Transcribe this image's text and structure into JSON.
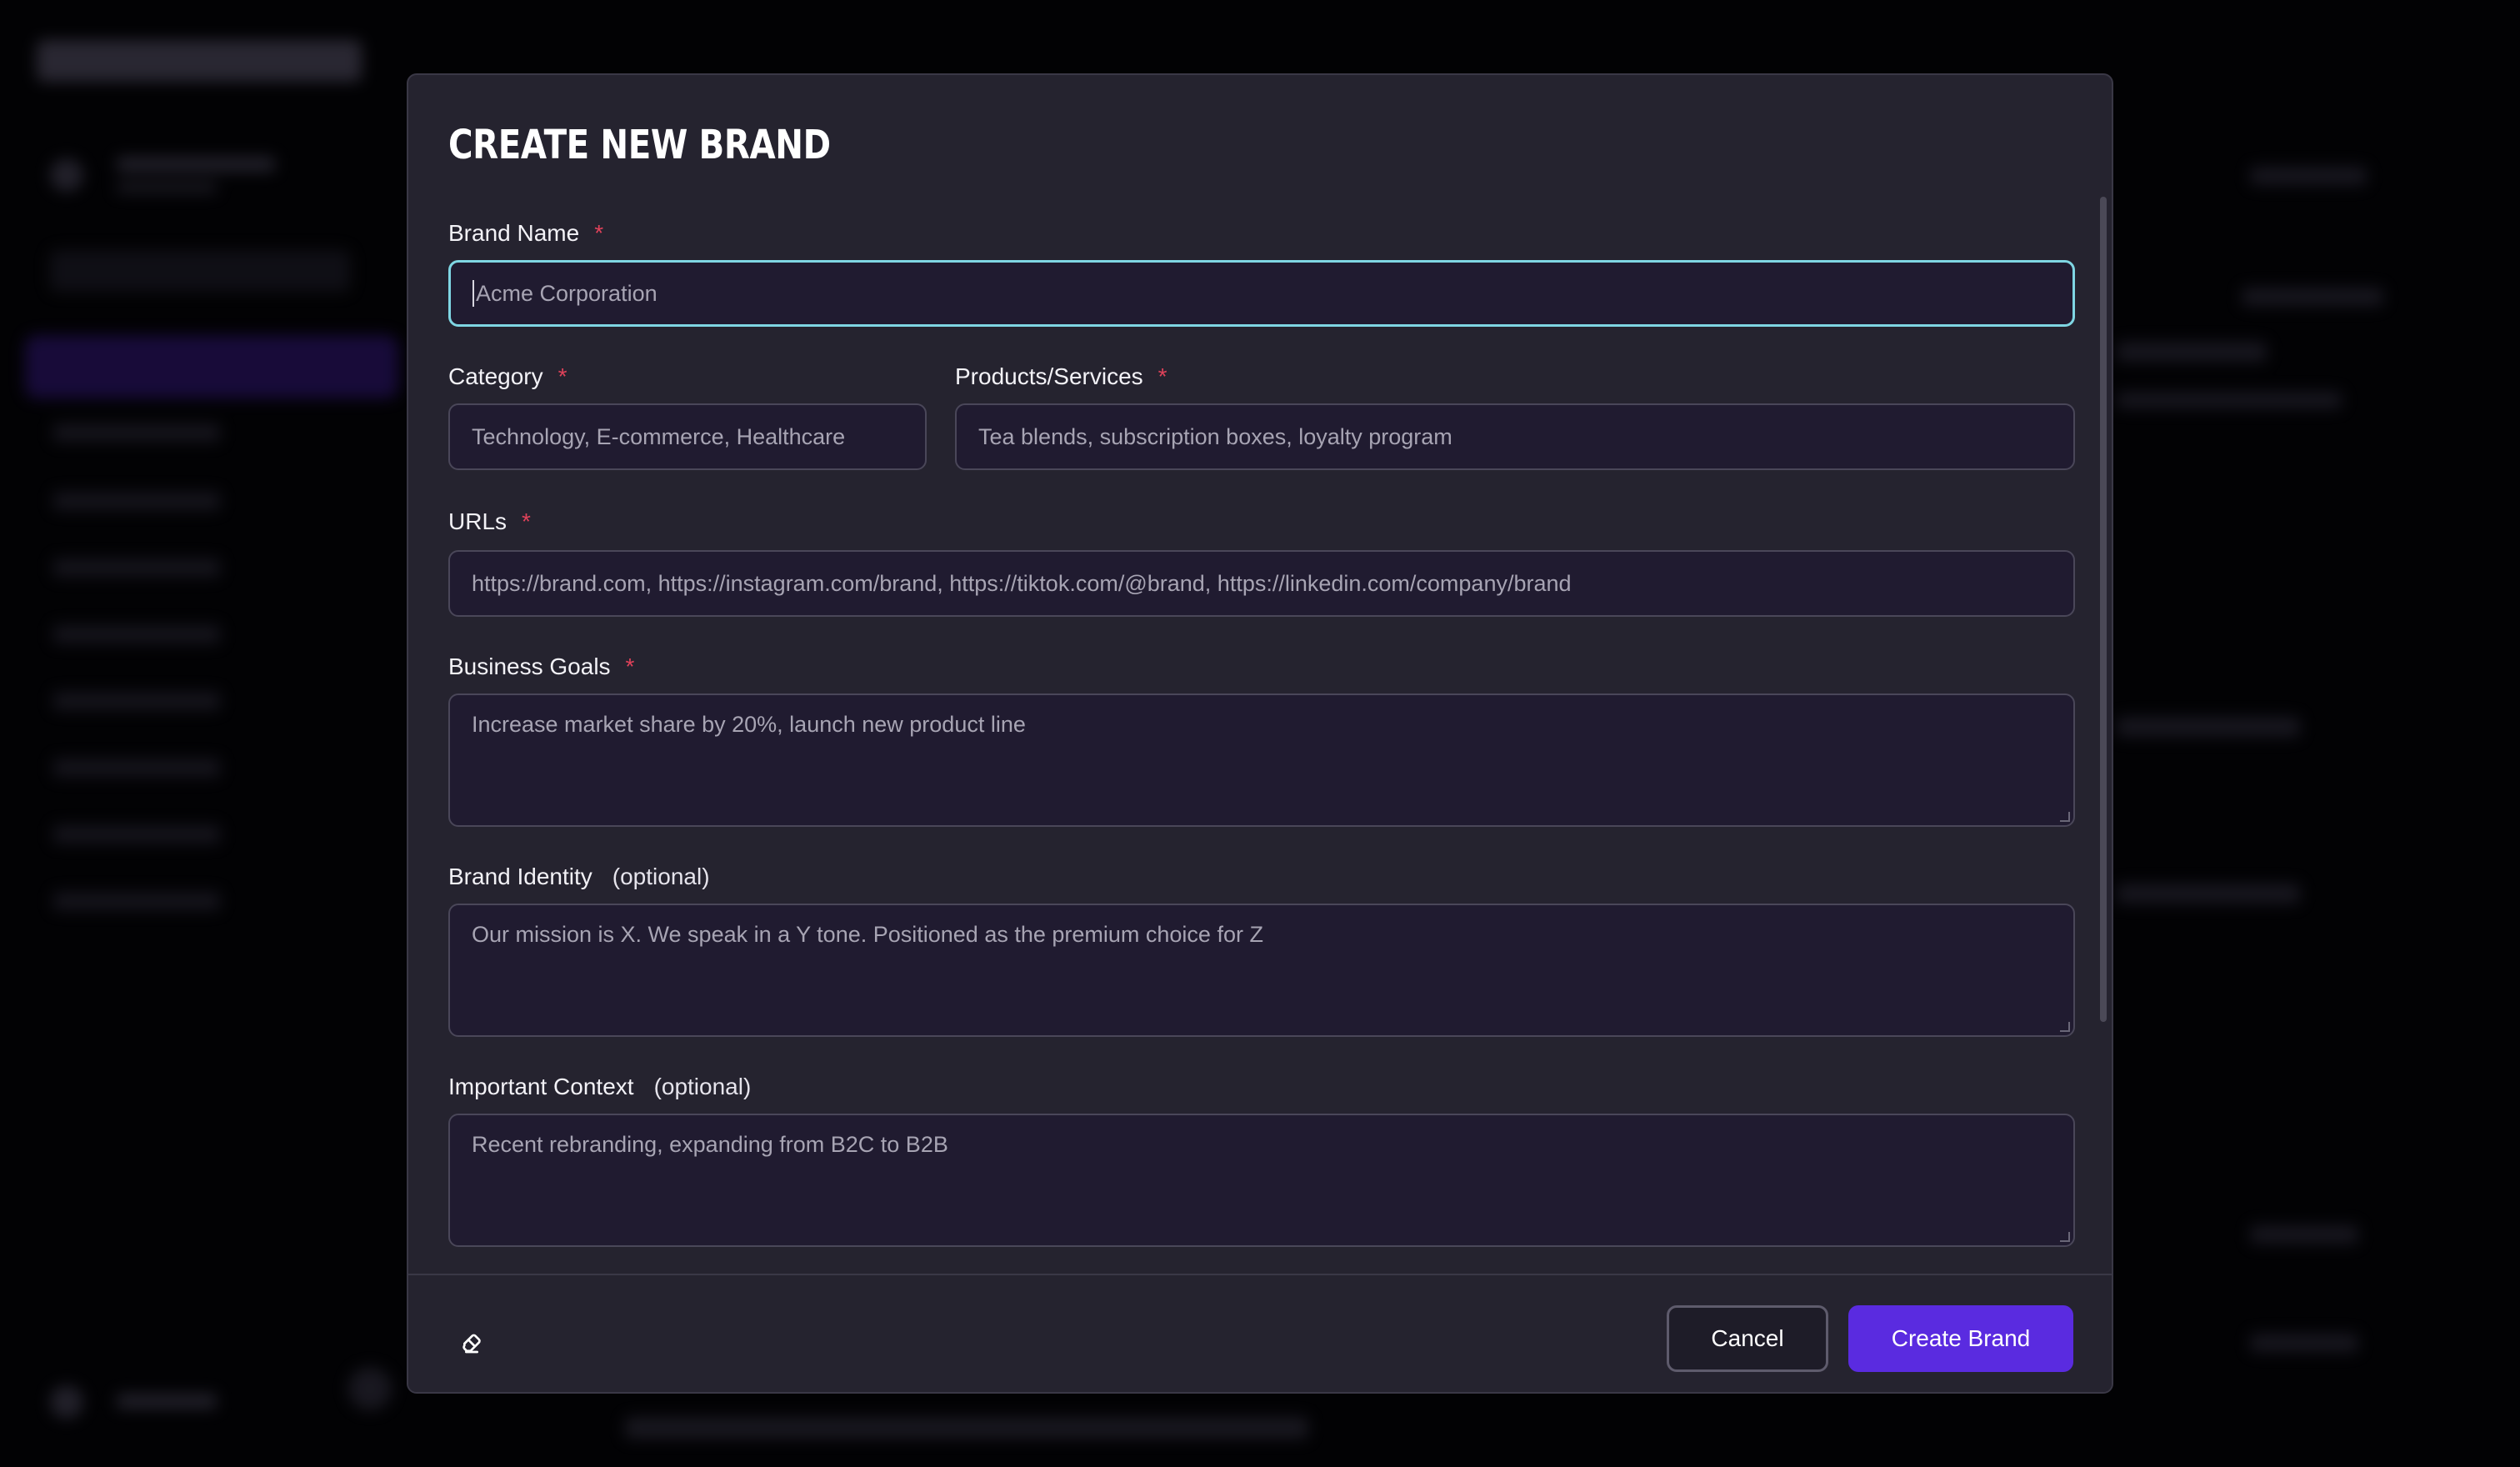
{
  "modal": {
    "title": "CREATE NEW BRAND",
    "fields": {
      "brand_name": {
        "label": "Brand Name",
        "required_mark": "*",
        "placeholder": "Acme Corporation"
      },
      "category": {
        "label": "Category",
        "required_mark": "*",
        "placeholder": "Technology, E-commerce, Healthcare"
      },
      "products": {
        "label": "Products/Services",
        "required_mark": "*",
        "placeholder": "Tea blends, subscription boxes, loyalty program"
      },
      "urls": {
        "label": "URLs",
        "required_mark": "*",
        "placeholder": "https://brand.com, https://instagram.com/brand, https://tiktok.com/@brand, https://linkedin.com/company/brand"
      },
      "business_goals": {
        "label": "Business Goals",
        "required_mark": "*",
        "placeholder": "Increase market share by 20%, launch new product line"
      },
      "brand_identity": {
        "label": "Brand Identity",
        "optional_mark": "(optional)",
        "placeholder": "Our mission is X. We speak in a Y tone. Positioned as the premium choice for Z"
      },
      "important_context": {
        "label": "Important Context",
        "optional_mark": "(optional)",
        "placeholder": "Recent rebranding, expanding from B2C to B2B"
      }
    },
    "footer": {
      "clear_icon": "eraser-icon",
      "cancel_label": "Cancel",
      "create_label": "Create Brand"
    }
  },
  "colors": {
    "accent": "#5a2be0",
    "focus_ring": "#7fd6e3",
    "required": "#e0425a",
    "modal_bg": "#25232f"
  }
}
